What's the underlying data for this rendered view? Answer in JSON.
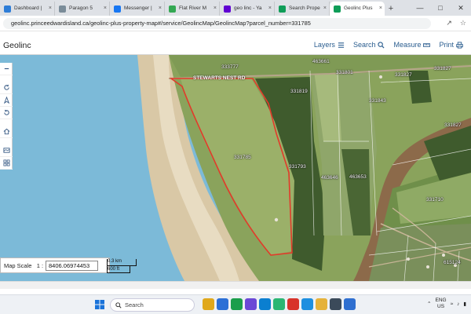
{
  "browser": {
    "tabs": [
      {
        "label": "Dashboard |",
        "color": "#2e7dd7"
      },
      {
        "label": "Paragon 5",
        "color": "#7a8c99"
      },
      {
        "label": "Messenger |",
        "color": "#1877f2"
      },
      {
        "label": "Flat River M",
        "color": "#34a853"
      },
      {
        "label": "geo linc - Ya",
        "color": "#6001d2"
      },
      {
        "label": "Search Prope",
        "color": "#0f9d58"
      },
      {
        "label": "Geolinc Plus",
        "color": "#0f9d58",
        "active": true
      }
    ],
    "new_tab": "+",
    "url": "geolinc.princeedwardisland.ca/geolinc-plus-property-map#/service/GeolincMap/GeolincMap?parcel_number=331785"
  },
  "app": {
    "logo": "Geolinc",
    "nav": {
      "layers": "Layers",
      "search": "Search",
      "measure": "Measure",
      "print": "Print"
    }
  },
  "map": {
    "road_label": "STEWARTS NEST RD",
    "parcel_labels": [
      {
        "text": "333777"
      },
      {
        "text": "463661"
      },
      {
        "text": "331801"
      },
      {
        "text": "331827"
      },
      {
        "text": "331827"
      },
      {
        "text": "331819"
      },
      {
        "text": "331843"
      },
      {
        "text": "331827"
      },
      {
        "text": "331785"
      },
      {
        "text": "331793"
      },
      {
        "text": "463646"
      },
      {
        "text": "463653"
      },
      {
        "text": "331710"
      },
      {
        "text": "615124"
      }
    ]
  },
  "scale": {
    "label": "Map Scale",
    "prefix": "1 :",
    "value": "8406.06974453",
    "bar_km": "0.3 km",
    "bar_ft": "600 ft"
  },
  "taskbar": {
    "search_placeholder": "Search",
    "lang_top": "ENG",
    "lang_bottom": "US",
    "apps": [
      "#e0a81c",
      "#2c6fd6",
      "#1b9e4b",
      "#6b48d6",
      "#0b7fd0",
      "#2bb673",
      "#d8332b",
      "#1d8fe0",
      "#e5b23a",
      "#3b4a5a",
      "#2f6fd0"
    ]
  }
}
